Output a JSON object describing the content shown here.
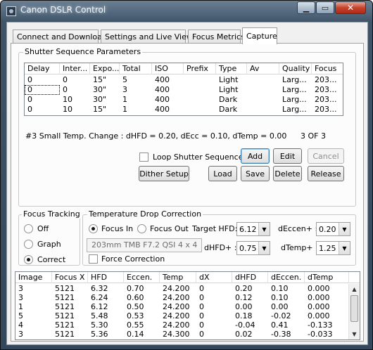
{
  "window": {
    "title": "Canon DSLR Control",
    "min_glyph": "▁",
    "max_glyph": "▭",
    "close_glyph": "✕"
  },
  "tabs": [
    {
      "label": "Connect and Download"
    },
    {
      "label": "Settings and Live View"
    },
    {
      "label": "Focus Metrics"
    },
    {
      "label": "Capture"
    }
  ],
  "shutter": {
    "legend": "Shutter Sequence Parameters",
    "columns": [
      "Delay",
      "Inter...",
      "Expo...",
      "Total",
      "ISO",
      "Prefix",
      "Type",
      "Av",
      "Quality",
      "Focus"
    ],
    "rows": [
      [
        "0",
        "0",
        "15\"",
        "5",
        "400",
        "",
        "Light",
        "",
        "Larg...",
        "203..."
      ],
      [
        "0",
        "0",
        "30\"",
        "3",
        "400",
        "",
        "Light",
        "",
        "Larg...",
        "203..."
      ],
      [
        "0",
        "10",
        "30\"",
        "1",
        "400",
        "",
        "Dark",
        "",
        "Larg...",
        "203..."
      ],
      [
        "0",
        "10",
        "15\"",
        "1",
        "400",
        "",
        "Dark",
        "",
        "Larg...",
        "203..."
      ]
    ],
    "status": "#3 Small Temp. Change : dHFD = 0.20, dEcc = 0.10, dTemp = 0.00",
    "counter": "3  OF  3",
    "loop_label": "Loop Shutter Sequence",
    "buttons": {
      "add": "Add",
      "edit": "Edit",
      "cancel": "Cancel",
      "dither": "Dither Setup",
      "load": "Load",
      "save": "Save",
      "delete": "Delete",
      "release": "Release"
    }
  },
  "focus_tracking": {
    "legend": "Focus Tracking",
    "options": [
      "Off",
      "Graph",
      "Correct"
    ],
    "selected": "Correct"
  },
  "temp_drop": {
    "legend": "Temperature Drop Correction",
    "focus_in": "Focus In",
    "focus_out": "Focus Out",
    "selected": "Focus In",
    "target_hfd_label": "Target HFD:",
    "target_hfd": "6.12",
    "decc_plus_label": "dEccen+ :",
    "decc_plus": "0.20",
    "profile": "203mm TMB F7.2 QSI 4 x 4",
    "dhfd_plus_label": "dHFD+ :",
    "dhfd_plus": "0.75",
    "dtemp_plus_label": "dTemp+ :",
    "dtemp_plus": "1.25",
    "force_label": "Force Correction"
  },
  "focus_log": {
    "columns": [
      "Image",
      "Focus X",
      "HFD",
      "Eccen.",
      "Temp",
      "dX",
      "dHFD",
      "dEccen.",
      "dTemp"
    ],
    "rows": [
      [
        "3",
        "5121",
        "6.32",
        "0.70",
        "24.200",
        "0",
        "0.20",
        "0.10",
        "0.000"
      ],
      [
        "3",
        "5121",
        "6.24",
        "0.60",
        "24.200",
        "0",
        "0.12",
        "0.10",
        "0.000"
      ],
      [
        "1",
        "5121",
        "6.12",
        "0.50",
        "24.200",
        "0",
        "0.00",
        "0.00",
        "0.000"
      ],
      [
        "5",
        "5121",
        "5.48",
        "0.53",
        "24.200",
        "0",
        "0.18",
        "-0.02",
        "0.000"
      ],
      [
        "4",
        "5121",
        "5.30",
        "0.55",
        "24.200",
        "0",
        "-0.04",
        "0.41",
        "-0.133"
      ],
      [
        "3",
        "5121",
        "5.36",
        "0.14",
        "24.300",
        "0",
        "0.02",
        "-0.38",
        "-0.033"
      ]
    ]
  }
}
